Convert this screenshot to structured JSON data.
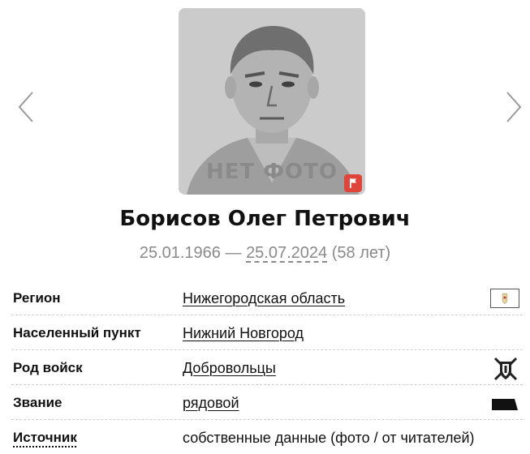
{
  "photo": {
    "placeholder_text": "НЕТ ФОТО",
    "flag_icon": "flag-icon"
  },
  "person": {
    "name": "Борисов Олег Петрович",
    "birth_date": "25.01.1966",
    "date_separator": "—",
    "death_date": "25.07.2024",
    "age": "(58 лет)"
  },
  "details": {
    "region_label": "Регион",
    "region_value": "Нижегородская область",
    "settlement_label": "Населенный пункт",
    "settlement_value": "Нижний Новгород",
    "branch_label": "Род войск",
    "branch_value": "Добровольцы",
    "rank_label": "Звание",
    "rank_value": "рядовой",
    "source_label": "Источник",
    "source_value": "собственные данные (фото / от читателей)"
  },
  "icons": {
    "prev": "chevron-left-icon",
    "next": "chevron-right-icon",
    "region": "region-emblem-icon",
    "branch": "volunteers-emblem-icon",
    "rank": "rank-insignia-icon"
  },
  "colors": {
    "flag": "#e0453c",
    "muted": "#8a8a8a",
    "text": "#111111"
  }
}
